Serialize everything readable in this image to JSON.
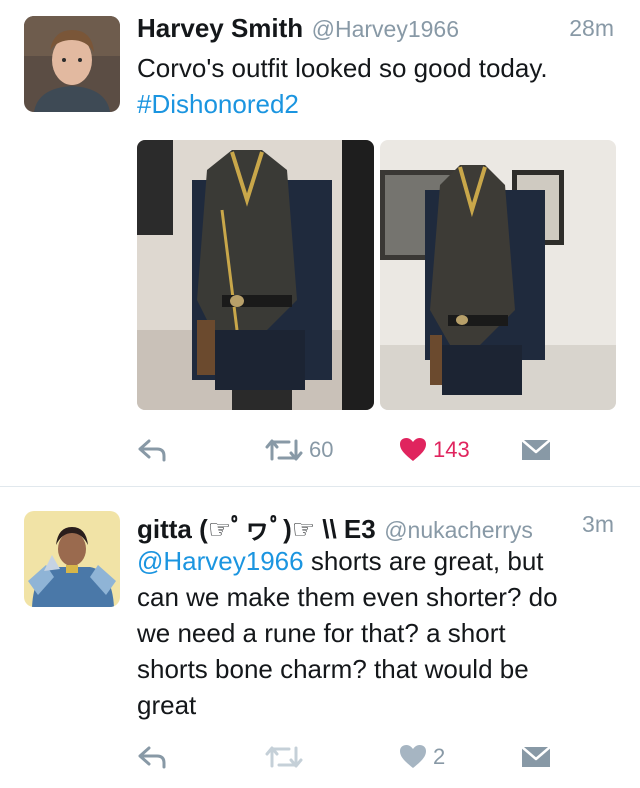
{
  "tweets": [
    {
      "name": "Harvey Smith",
      "handle": "@Harvey1966",
      "time": "28m",
      "text": "Corvo's outfit looked so good today.",
      "hashtag": "#Dishonored2",
      "retweets": "60",
      "likes": "143",
      "avatar_icon": "person-photo",
      "photo_icons": [
        "mannequin-outfit-photo",
        "mannequin-outfit-photo"
      ]
    },
    {
      "name": "gitta (☞ﾟヮﾟ)☞ \\\\ E3",
      "handle": "@nukacherrys",
      "time": "3m",
      "mention": "@Harvey1966",
      "text_line1": " shorts are great, but",
      "text_line2": "can we make them even shorter? do",
      "text_line3": "we need a rune for that? a short",
      "text_line4": "shorts bone charm? that would be",
      "text_line5": "great",
      "likes": "2",
      "avatar_icon": "character-art-avatar"
    }
  ],
  "colors": {
    "link": "#1b95e0",
    "muted": "#8899a6",
    "like_active": "#e0245e",
    "divider": "#e1e8ed"
  },
  "icons": [
    "reply-icon",
    "retweet-icon",
    "heart-icon",
    "dm-envelope-icon"
  ]
}
